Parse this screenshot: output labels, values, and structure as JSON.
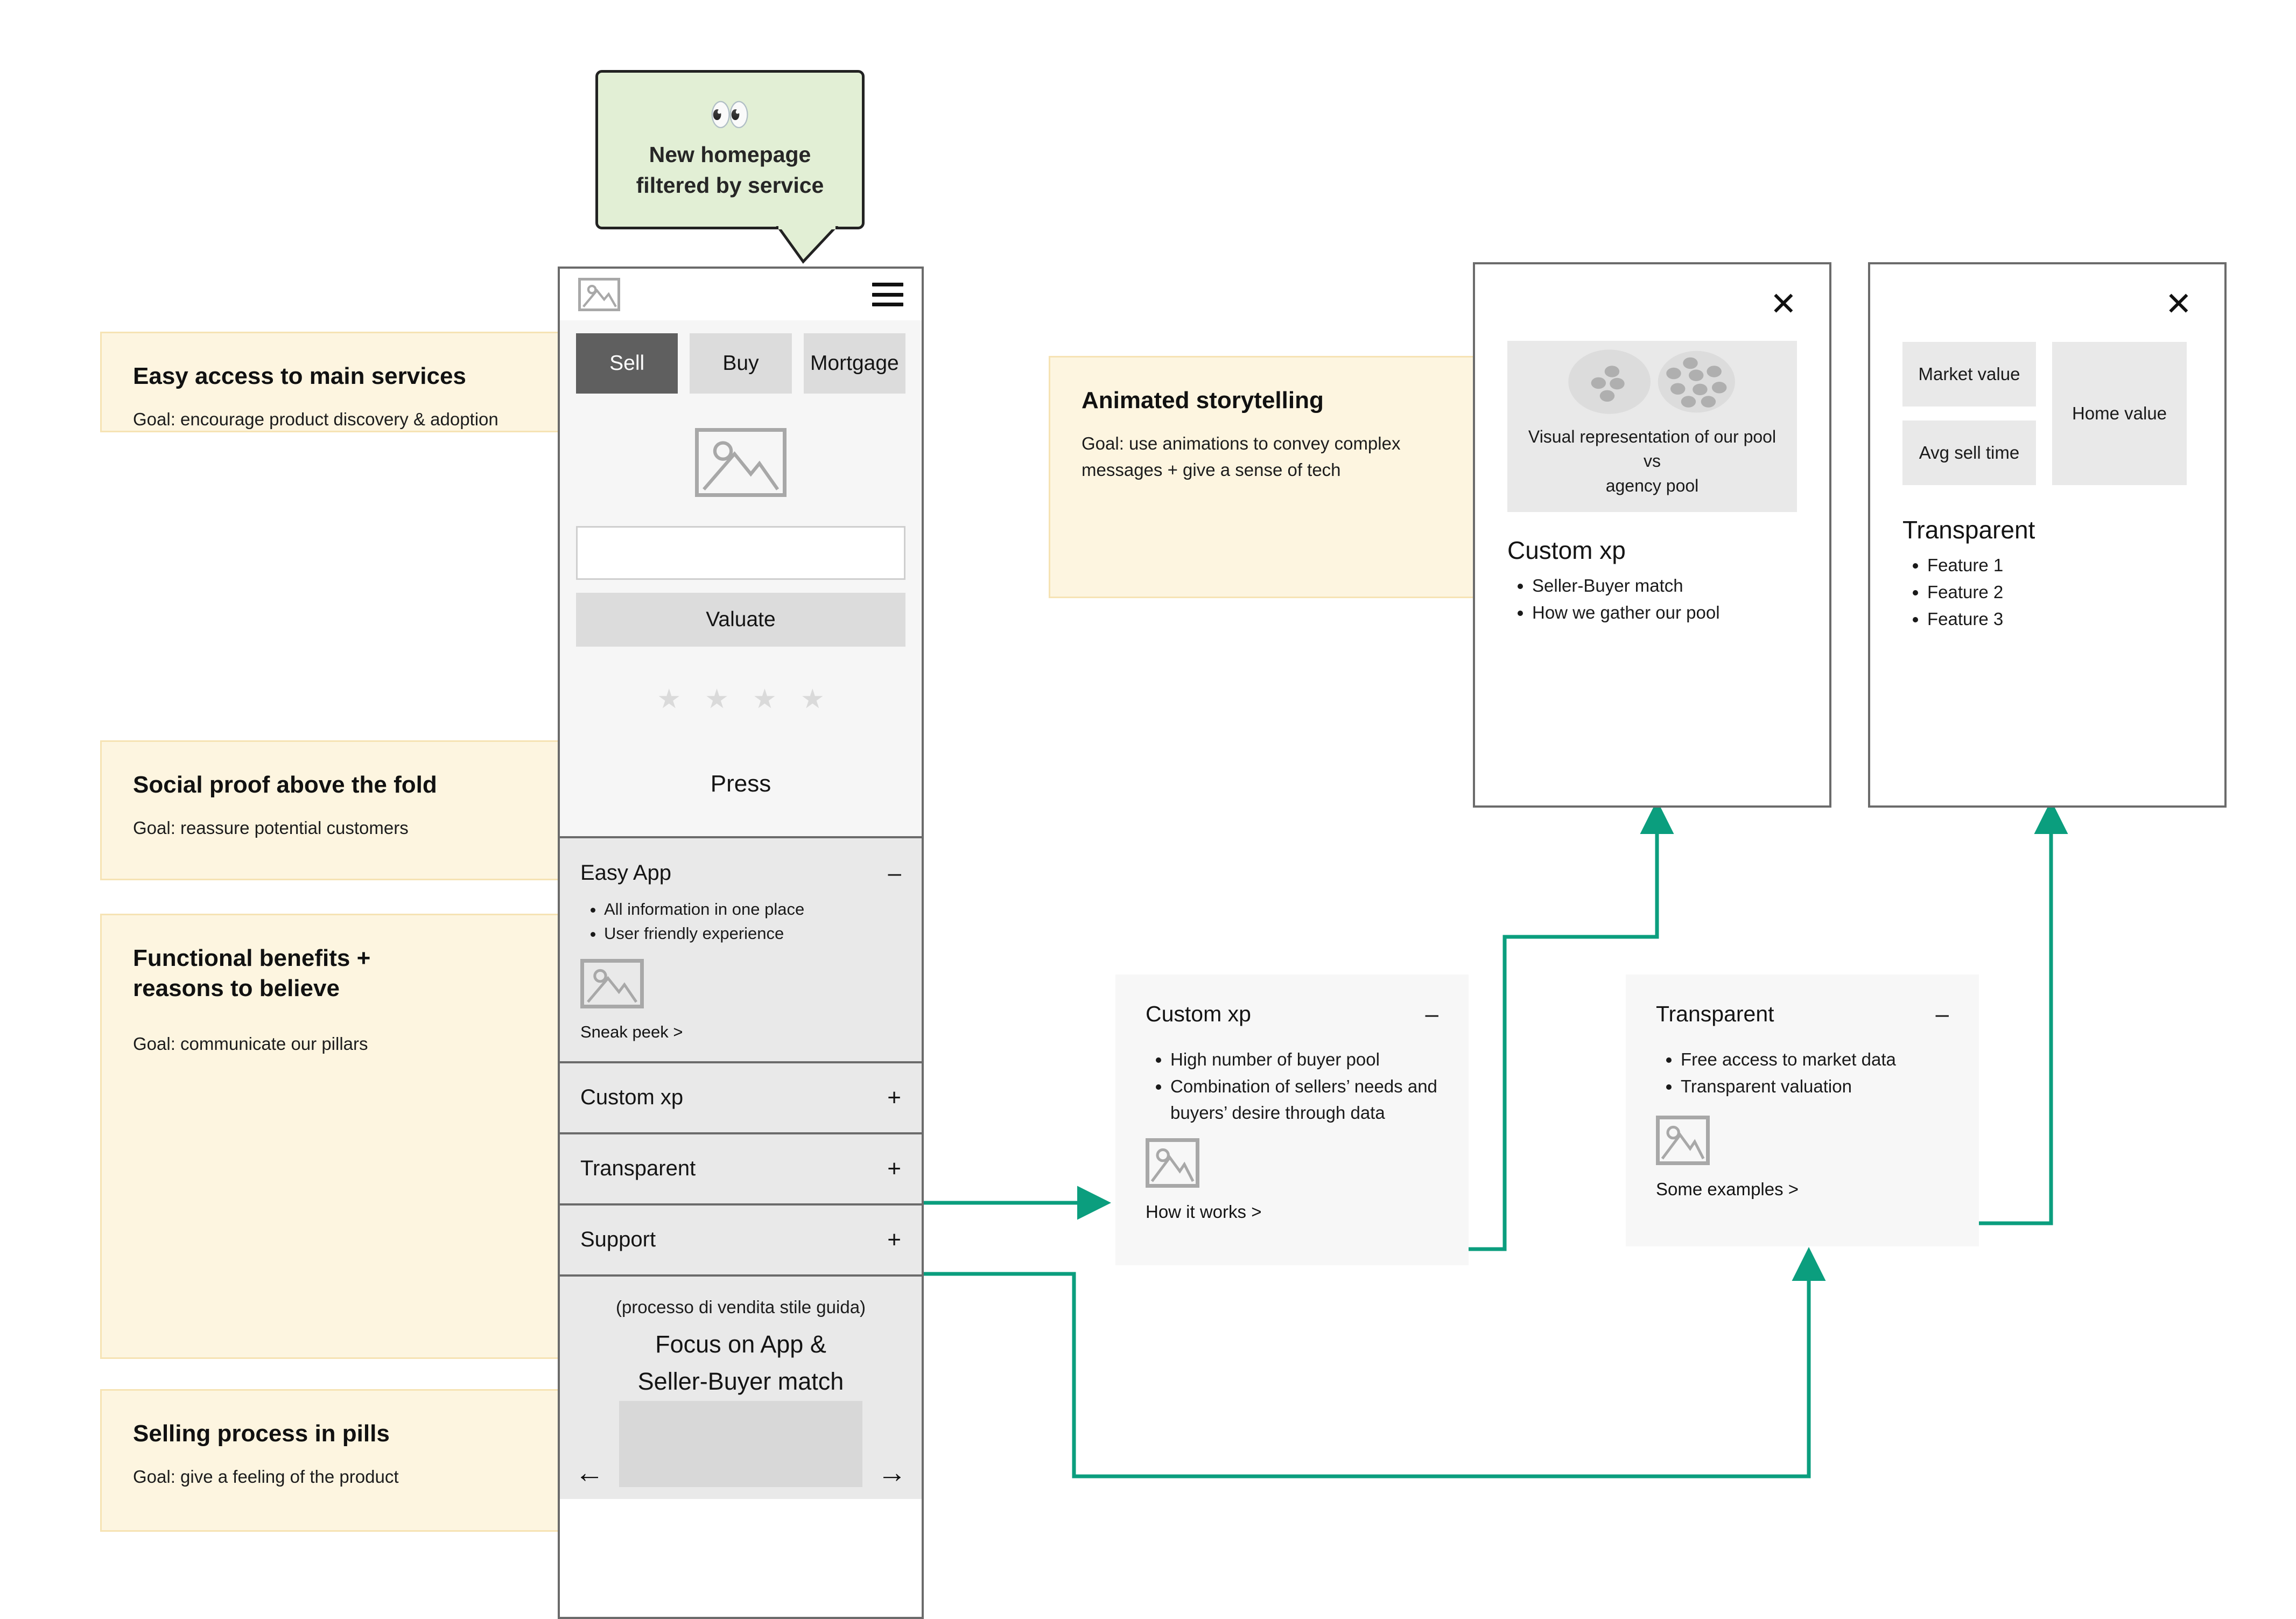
{
  "callout": {
    "icon": "eyes-emoji",
    "glyph": "👀",
    "line1": "New homepage",
    "line2": "filtered by service",
    "bg": "#e2efd5"
  },
  "notes": [
    {
      "title": "Easy access to main services",
      "goal": "Goal: encourage product discovery & adoption"
    },
    {
      "title": "Social proof above the fold",
      "goal": "Goal: reassure potential customers"
    },
    {
      "title_line1": "Functional benefits +",
      "title_line2": "reasons to believe",
      "goal": "Goal: communicate our pillars"
    },
    {
      "title": "Selling process in pills",
      "goal": "Goal: give a feeling of the product"
    },
    {
      "title": "Animated storytelling",
      "goal_line1": "Goal: use animations to convey complex",
      "goal_line2": "messages + give a sense of tech"
    }
  ],
  "phone": {
    "logo_icon": "image-placeholder-icon",
    "menu_icon": "hamburger-menu-icon",
    "tabs": [
      {
        "label": "Sell",
        "active": true
      },
      {
        "label": "Buy",
        "active": false
      },
      {
        "label": "Mortgage",
        "active": false
      }
    ],
    "hero_icon": "image-placeholder-icon",
    "address_input_value": "",
    "address_input_placeholder": "",
    "valuate_label": "Valuate",
    "rating_stars": 4,
    "star_glyph": "★",
    "press_label": "Press",
    "accordion": [
      {
        "label": "Easy App",
        "sign": "–",
        "expanded": true,
        "bullets": [
          "All information in one place",
          "User friendly experience"
        ],
        "media_icon": "image-placeholder-icon",
        "link": "Sneak peek >"
      },
      {
        "label": "Custom xp",
        "sign": "+",
        "expanded": false
      },
      {
        "label": "Transparent",
        "sign": "+",
        "expanded": false
      },
      {
        "label": "Support",
        "sign": "+",
        "expanded": false
      }
    ],
    "footer": {
      "note": "(processo di vendita stile guida)",
      "headline_line1": "Focus on App &",
      "headline_line2": "Seller-Buyer match"
    },
    "carousel": {
      "prev_icon": "arrow-left-icon",
      "prev_glyph": "←",
      "next_icon": "arrow-right-icon",
      "next_glyph": "→"
    }
  },
  "modals": [
    {
      "close_icon": "close-x-icon",
      "close_glyph": "✕",
      "media_caption_line1": "Visual representation of our pool vs",
      "media_caption_line2": "agency pool",
      "media_kind": "two-pool-dots-diagram",
      "pool_left_dots": 4,
      "pool_right_dots": 8,
      "title": "Custom xp",
      "bullets": [
        "Seller-Buyer match",
        "How we gather our pool"
      ]
    },
    {
      "close_icon": "close-x-icon",
      "close_glyph": "✕",
      "kpi_boxes": [
        {
          "label": "Market value"
        },
        {
          "label": "Avg sell time"
        },
        {
          "label": "Home value"
        }
      ],
      "title": "Transparent",
      "bullets": [
        "Feature 1",
        "Feature 2",
        "Feature 3"
      ]
    }
  ],
  "detail_cards": [
    {
      "title": "Custom xp",
      "sign": "–",
      "bullets": [
        "High number of buyer pool",
        "Combination of sellers’ needs and buyers’ desire through data"
      ],
      "media_icon": "image-placeholder-icon",
      "link": "How it works >"
    },
    {
      "title": "Transparent",
      "sign": "–",
      "bullets": [
        "Free access to market data",
        "Transparent valuation"
      ],
      "media_icon": "image-placeholder-icon",
      "link": "Some examples >"
    }
  ],
  "colors": {
    "connector": "#0b9e7e",
    "note_bg": "#fdf5e0",
    "note_border": "#f6e3b4",
    "callout_bg": "#e2efd5",
    "frame": "#6b6b6b",
    "tab_active": "#5f5f5f",
    "tab_idle": "#dcdcdc",
    "panel": "#e9e9e9"
  }
}
